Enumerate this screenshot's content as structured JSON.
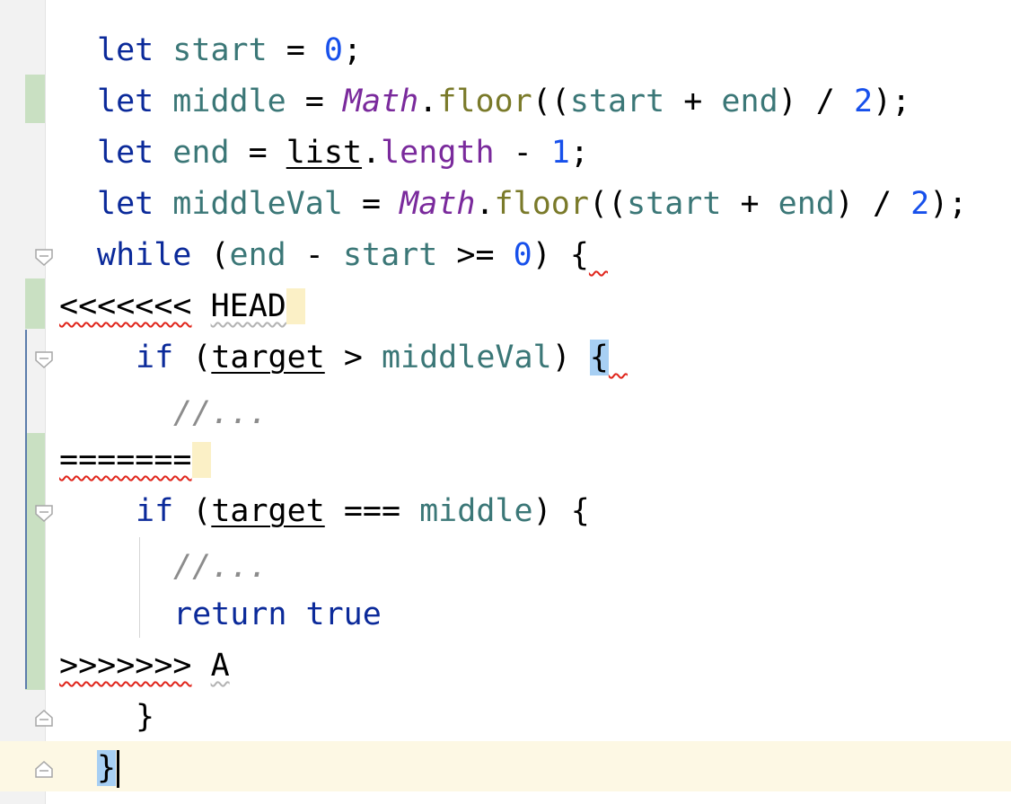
{
  "editor": {
    "lines": [
      {
        "tokens": [
          {
            "t": "let",
            "c": "kw"
          },
          {
            "t": " "
          },
          {
            "t": "start",
            "c": "var"
          },
          {
            "t": " = "
          },
          {
            "t": "0",
            "c": "num"
          },
          {
            "t": ";"
          }
        ]
      },
      {
        "tokens": [
          {
            "t": "let",
            "c": "kw"
          },
          {
            "t": " "
          },
          {
            "t": "middle",
            "c": "var"
          },
          {
            "t": " = "
          },
          {
            "t": "Math",
            "c": "cls"
          },
          {
            "t": "."
          },
          {
            "t": "floor",
            "c": "fn"
          },
          {
            "t": "(("
          },
          {
            "t": "start",
            "c": "var"
          },
          {
            "t": " + "
          },
          {
            "t": "end",
            "c": "var"
          },
          {
            "t": ") / "
          },
          {
            "t": "2",
            "c": "num"
          },
          {
            "t": ");"
          }
        ]
      },
      {
        "tokens": [
          {
            "t": "let",
            "c": "kw"
          },
          {
            "t": " "
          },
          {
            "t": "end",
            "c": "var"
          },
          {
            "t": " = "
          },
          {
            "t": "list",
            "c": "ul"
          },
          {
            "t": "."
          },
          {
            "t": "length",
            "c": "prop"
          },
          {
            "t": " - "
          },
          {
            "t": "1",
            "c": "num"
          },
          {
            "t": ";"
          }
        ]
      },
      {
        "tokens": [
          {
            "t": "let",
            "c": "kw"
          },
          {
            "t": " "
          },
          {
            "t": "middleVal",
            "c": "var"
          },
          {
            "t": " = "
          },
          {
            "t": "Math",
            "c": "cls"
          },
          {
            "t": "."
          },
          {
            "t": "floor",
            "c": "fn"
          },
          {
            "t": "(("
          },
          {
            "t": "start",
            "c": "var"
          },
          {
            "t": " + "
          },
          {
            "t": "end",
            "c": "var"
          },
          {
            "t": ") / "
          },
          {
            "t": "2",
            "c": "num"
          },
          {
            "t": ");"
          }
        ]
      },
      {
        "tokens": [
          {
            "t": "while",
            "c": "kw"
          },
          {
            "t": " ("
          },
          {
            "t": "end",
            "c": "var"
          },
          {
            "t": " - "
          },
          {
            "t": "start",
            "c": "var"
          },
          {
            "t": " >= "
          },
          {
            "t": "0",
            "c": "num"
          },
          {
            "t": ") "
          },
          {
            "t": "{"
          },
          {
            "t": " ",
            "c": "err"
          }
        ]
      },
      {
        "tokens": [
          {
            "t": "<<<<<<<",
            "c": "err"
          },
          {
            "t": " "
          },
          {
            "t": "HEAD",
            "c": "warn"
          },
          {
            "t": " ",
            "c": "hl-yellow"
          }
        ]
      },
      {
        "tokens": [
          {
            "t": "if",
            "c": "kw"
          },
          {
            "t": " ("
          },
          {
            "t": "target",
            "c": "ul"
          },
          {
            "t": " > "
          },
          {
            "t": "middleVal",
            "c": "var"
          },
          {
            "t": ") "
          },
          {
            "t": "{",
            "c": "hl-blue"
          },
          {
            "t": " ",
            "c": "err"
          }
        ]
      },
      {
        "tokens": [
          {
            "t": "//...",
            "c": "cmt"
          }
        ]
      },
      {
        "tokens": [
          {
            "t": "=======",
            "c": "err"
          },
          {
            "t": " ",
            "c": "hl-yellow"
          }
        ]
      },
      {
        "tokens": [
          {
            "t": "if",
            "c": "kw"
          },
          {
            "t": " ("
          },
          {
            "t": "target",
            "c": "ul"
          },
          {
            "t": " === "
          },
          {
            "t": "middle",
            "c": "var"
          },
          {
            "t": ") {"
          }
        ]
      },
      {
        "tokens": [
          {
            "t": "//...",
            "c": "cmt"
          }
        ]
      },
      {
        "tokens": [
          {
            "t": "return",
            "c": "kw"
          },
          {
            "t": " "
          },
          {
            "t": "true",
            "c": "kw"
          }
        ]
      },
      {
        "tokens": [
          {
            "t": ">>>>>>>",
            "c": "err"
          },
          {
            "t": " "
          },
          {
            "t": "A",
            "c": "warn"
          }
        ]
      },
      {
        "tokens": [
          {
            "t": "}"
          }
        ]
      },
      {
        "tokens": [
          {
            "t": "}",
            "c": "hl-blue"
          }
        ]
      }
    ]
  }
}
